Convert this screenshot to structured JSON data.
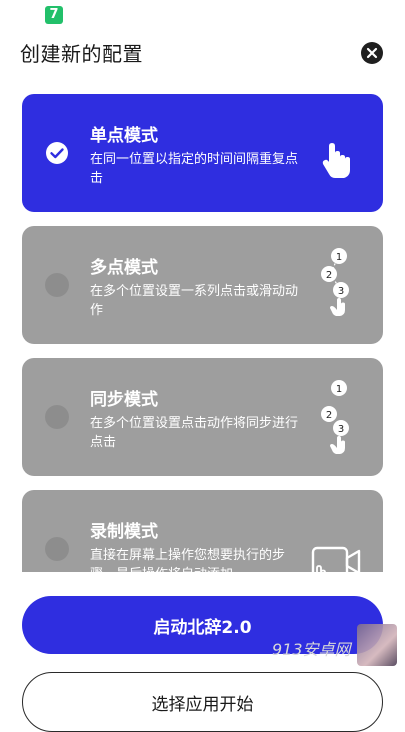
{
  "status_bar": {
    "app_badge": "7"
  },
  "header": {
    "title": "创建新的配置"
  },
  "icons": {
    "close": "close-icon",
    "check": "check-icon",
    "tap": "tap-hand-icon",
    "multi_tap": "multi-tap-icon",
    "sync_tap": "sync-tap-icon",
    "record": "screen-record-icon"
  },
  "modes": [
    {
      "title": "单点模式",
      "description": "在同一位置以指定的时间间隔重复点击",
      "selected": true
    },
    {
      "title": "多点模式",
      "description": "在多个位置设置一系列点击或滑动动作",
      "selected": false
    },
    {
      "title": "同步模式",
      "description": "在多个位置设置点击动作将同步进行点击",
      "selected": false
    },
    {
      "title": "录制模式",
      "description": "直接在屏幕上操作您想要执行的步骤，最后操作将自动添加",
      "selected": false
    }
  ],
  "step_numbers": [
    "1",
    "2",
    "3"
  ],
  "actions": {
    "start_label": "启动北辞2.0",
    "choose_app_label": "选择应用开始"
  },
  "watermark": {
    "text": "913安卓网"
  },
  "colors": {
    "accent": "#2f2ee0",
    "card_inactive": "#9e9e9e",
    "text_dark": "#1a1a1a"
  }
}
